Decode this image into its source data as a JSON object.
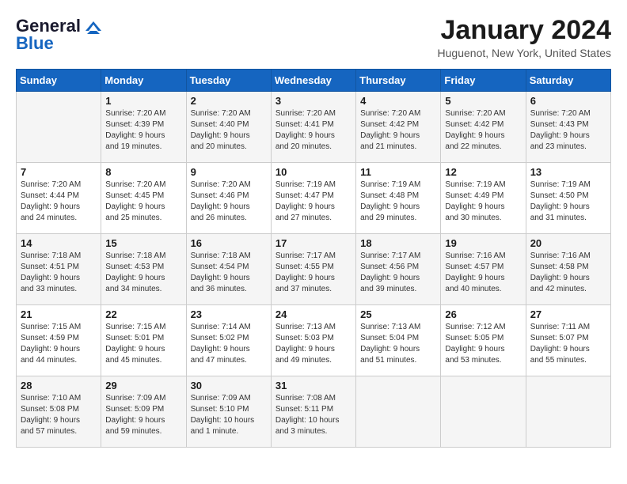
{
  "header": {
    "logo": {
      "line1": "General",
      "line2": "Blue"
    },
    "title": "January 2024",
    "location": "Huguenot, New York, United States"
  },
  "weekdays": [
    "Sunday",
    "Monday",
    "Tuesday",
    "Wednesday",
    "Thursday",
    "Friday",
    "Saturday"
  ],
  "weeks": [
    [
      {
        "day": "",
        "info": ""
      },
      {
        "day": "1",
        "info": "Sunrise: 7:20 AM\nSunset: 4:39 PM\nDaylight: 9 hours\nand 19 minutes."
      },
      {
        "day": "2",
        "info": "Sunrise: 7:20 AM\nSunset: 4:40 PM\nDaylight: 9 hours\nand 20 minutes."
      },
      {
        "day": "3",
        "info": "Sunrise: 7:20 AM\nSunset: 4:41 PM\nDaylight: 9 hours\nand 20 minutes."
      },
      {
        "day": "4",
        "info": "Sunrise: 7:20 AM\nSunset: 4:42 PM\nDaylight: 9 hours\nand 21 minutes."
      },
      {
        "day": "5",
        "info": "Sunrise: 7:20 AM\nSunset: 4:42 PM\nDaylight: 9 hours\nand 22 minutes."
      },
      {
        "day": "6",
        "info": "Sunrise: 7:20 AM\nSunset: 4:43 PM\nDaylight: 9 hours\nand 23 minutes."
      }
    ],
    [
      {
        "day": "7",
        "info": "Sunrise: 7:20 AM\nSunset: 4:44 PM\nDaylight: 9 hours\nand 24 minutes."
      },
      {
        "day": "8",
        "info": "Sunrise: 7:20 AM\nSunset: 4:45 PM\nDaylight: 9 hours\nand 25 minutes."
      },
      {
        "day": "9",
        "info": "Sunrise: 7:20 AM\nSunset: 4:46 PM\nDaylight: 9 hours\nand 26 minutes."
      },
      {
        "day": "10",
        "info": "Sunrise: 7:19 AM\nSunset: 4:47 PM\nDaylight: 9 hours\nand 27 minutes."
      },
      {
        "day": "11",
        "info": "Sunrise: 7:19 AM\nSunset: 4:48 PM\nDaylight: 9 hours\nand 29 minutes."
      },
      {
        "day": "12",
        "info": "Sunrise: 7:19 AM\nSunset: 4:49 PM\nDaylight: 9 hours\nand 30 minutes."
      },
      {
        "day": "13",
        "info": "Sunrise: 7:19 AM\nSunset: 4:50 PM\nDaylight: 9 hours\nand 31 minutes."
      }
    ],
    [
      {
        "day": "14",
        "info": "Sunrise: 7:18 AM\nSunset: 4:51 PM\nDaylight: 9 hours\nand 33 minutes."
      },
      {
        "day": "15",
        "info": "Sunrise: 7:18 AM\nSunset: 4:53 PM\nDaylight: 9 hours\nand 34 minutes."
      },
      {
        "day": "16",
        "info": "Sunrise: 7:18 AM\nSunset: 4:54 PM\nDaylight: 9 hours\nand 36 minutes."
      },
      {
        "day": "17",
        "info": "Sunrise: 7:17 AM\nSunset: 4:55 PM\nDaylight: 9 hours\nand 37 minutes."
      },
      {
        "day": "18",
        "info": "Sunrise: 7:17 AM\nSunset: 4:56 PM\nDaylight: 9 hours\nand 39 minutes."
      },
      {
        "day": "19",
        "info": "Sunrise: 7:16 AM\nSunset: 4:57 PM\nDaylight: 9 hours\nand 40 minutes."
      },
      {
        "day": "20",
        "info": "Sunrise: 7:16 AM\nSunset: 4:58 PM\nDaylight: 9 hours\nand 42 minutes."
      }
    ],
    [
      {
        "day": "21",
        "info": "Sunrise: 7:15 AM\nSunset: 4:59 PM\nDaylight: 9 hours\nand 44 minutes."
      },
      {
        "day": "22",
        "info": "Sunrise: 7:15 AM\nSunset: 5:01 PM\nDaylight: 9 hours\nand 45 minutes."
      },
      {
        "day": "23",
        "info": "Sunrise: 7:14 AM\nSunset: 5:02 PM\nDaylight: 9 hours\nand 47 minutes."
      },
      {
        "day": "24",
        "info": "Sunrise: 7:13 AM\nSunset: 5:03 PM\nDaylight: 9 hours\nand 49 minutes."
      },
      {
        "day": "25",
        "info": "Sunrise: 7:13 AM\nSunset: 5:04 PM\nDaylight: 9 hours\nand 51 minutes."
      },
      {
        "day": "26",
        "info": "Sunrise: 7:12 AM\nSunset: 5:05 PM\nDaylight: 9 hours\nand 53 minutes."
      },
      {
        "day": "27",
        "info": "Sunrise: 7:11 AM\nSunset: 5:07 PM\nDaylight: 9 hours\nand 55 minutes."
      }
    ],
    [
      {
        "day": "28",
        "info": "Sunrise: 7:10 AM\nSunset: 5:08 PM\nDaylight: 9 hours\nand 57 minutes."
      },
      {
        "day": "29",
        "info": "Sunrise: 7:09 AM\nSunset: 5:09 PM\nDaylight: 9 hours\nand 59 minutes."
      },
      {
        "day": "30",
        "info": "Sunrise: 7:09 AM\nSunset: 5:10 PM\nDaylight: 10 hours\nand 1 minute."
      },
      {
        "day": "31",
        "info": "Sunrise: 7:08 AM\nSunset: 5:11 PM\nDaylight: 10 hours\nand 3 minutes."
      },
      {
        "day": "",
        "info": ""
      },
      {
        "day": "",
        "info": ""
      },
      {
        "day": "",
        "info": ""
      }
    ]
  ]
}
